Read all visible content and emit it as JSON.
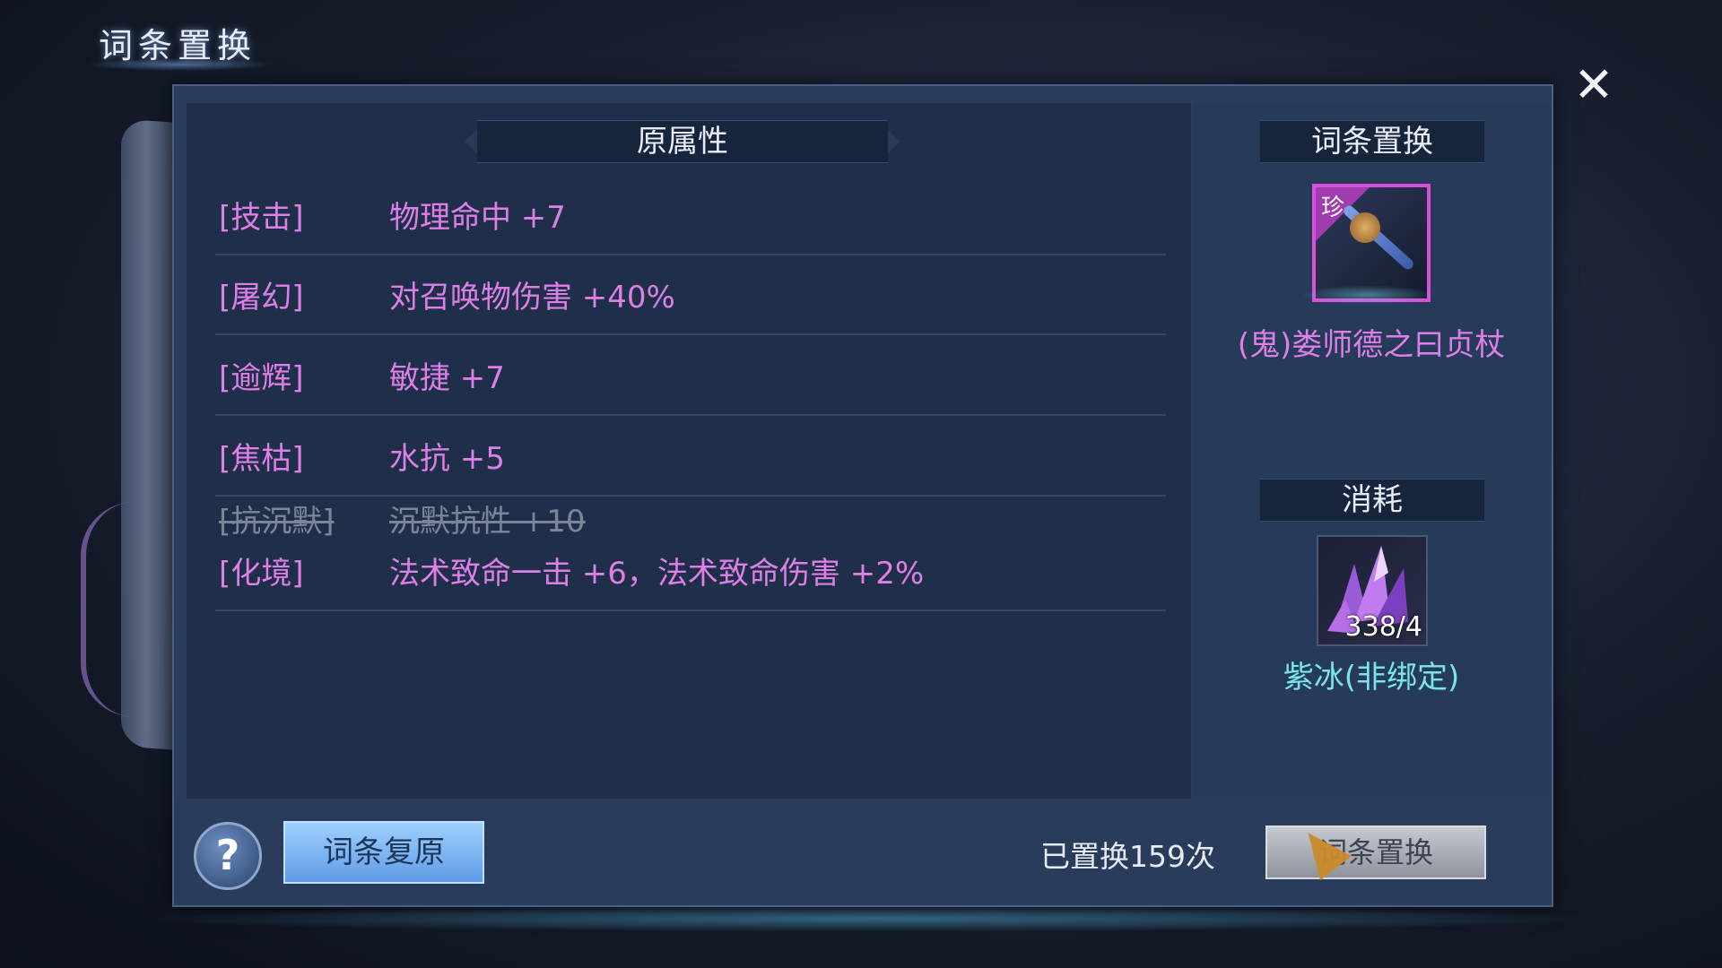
{
  "window": {
    "title": "词条置换",
    "close_icon": "close-icon"
  },
  "original": {
    "header": "原属性",
    "rows": [
      {
        "tag": "[技击]",
        "value": "物理命中 +7"
      },
      {
        "tag": "[屠幻]",
        "value": "对召唤物伤害 +40%"
      },
      {
        "tag": "[逾辉]",
        "value": "敏捷 +7"
      },
      {
        "tag": "[焦枯]",
        "value": "水抗 +5"
      },
      {
        "tag": "[抗沉默]",
        "value": "沉默抗性 +10",
        "struck": true
      },
      {
        "tag": "[化境]",
        "value": "法术致命一击 +6，法术致命伤害 +2%"
      }
    ]
  },
  "target": {
    "header": "词条置换",
    "item": {
      "rarity": "珍",
      "name": "(鬼)娄师德之曰贞杖",
      "icon": "staff-icon"
    }
  },
  "cost": {
    "header": "消耗",
    "material": {
      "count": "338/4",
      "name": "紫冰(非绑定)",
      "icon": "crystal-icon"
    }
  },
  "footer": {
    "help": "?",
    "restore_label": "词条复原",
    "replaced_count": "已置换159次",
    "replace_label": "词条置换"
  },
  "colors": {
    "attribute": "#dd7fe6",
    "material": "#7be3ea",
    "panel": "#2b3d5c"
  }
}
